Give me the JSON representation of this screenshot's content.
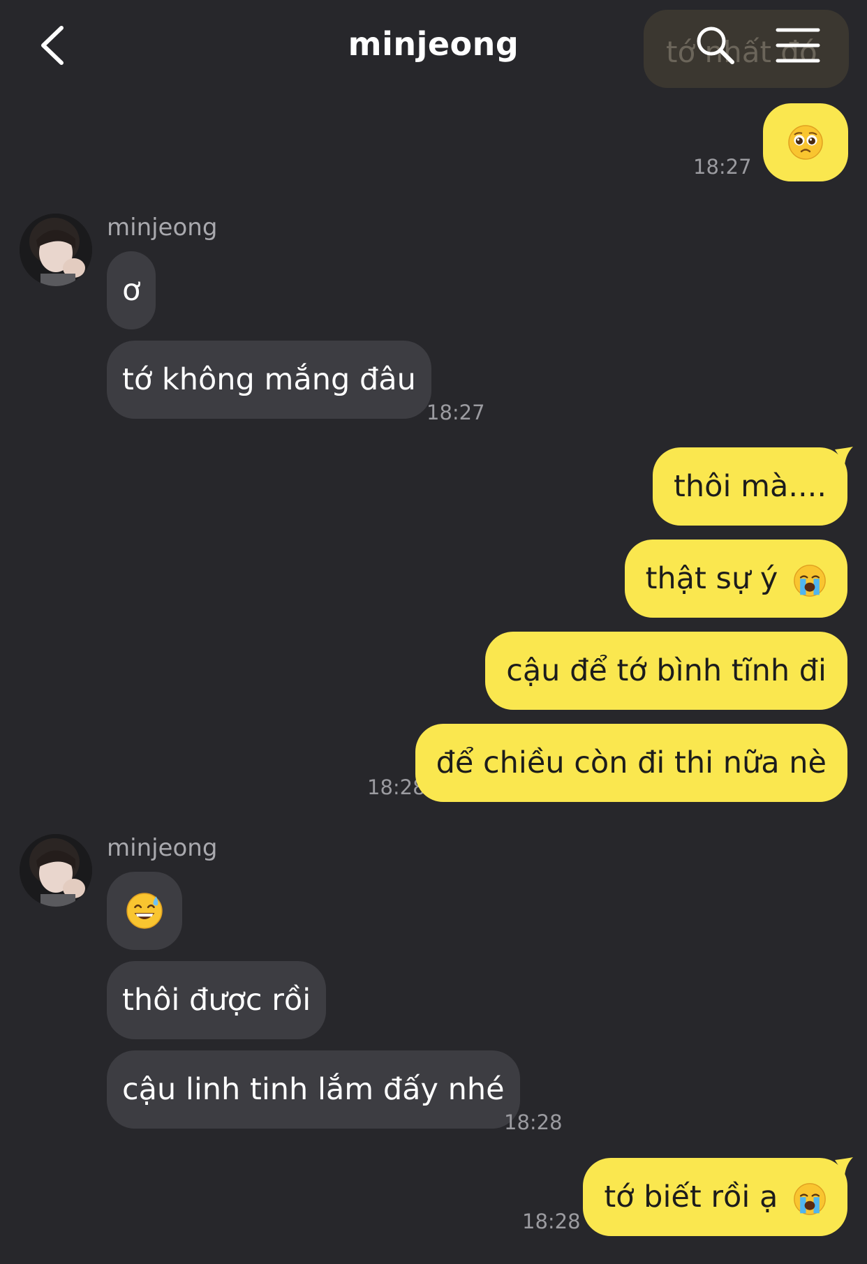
{
  "header": {
    "title": "minjeong",
    "peek_text": "tớ nhất đó",
    "back_icon": "chevron-left-icon",
    "search_icon": "search-icon",
    "menu_icon": "hamburger-menu-icon"
  },
  "colors": {
    "background": "#27272b",
    "my_bubble": "#fae74f",
    "their_bubble": "#3d3d42",
    "timestamp": "#9b9ba0"
  },
  "messages": [
    {
      "from": "me",
      "emoji": "pleading-face-emoji",
      "time": "18:27"
    },
    {
      "from": "them",
      "sender": "minjeong",
      "text": "ơ"
    },
    {
      "from": "them",
      "text": "tớ không mắng đâu",
      "time": "18:27"
    },
    {
      "from": "me",
      "text": "thôi mà...."
    },
    {
      "from": "me",
      "text": "thật sự ý",
      "emoji": "loudly-crying-face-emoji"
    },
    {
      "from": "me",
      "text": "cậu để tớ bình tĩnh đi"
    },
    {
      "from": "me",
      "text": "để chiều còn đi thi nữa nè",
      "time": "18:28"
    },
    {
      "from": "them",
      "sender": "minjeong",
      "emoji": "grinning-sweat-face-emoji"
    },
    {
      "from": "them",
      "text": "thôi được rồi"
    },
    {
      "from": "them",
      "text": "cậu linh tinh lắm đấy nhé",
      "time": "18:28"
    },
    {
      "from": "me",
      "text": "tớ biết rồi ạ",
      "emoji": "loudly-crying-face-emoji",
      "time": "18:28"
    }
  ]
}
